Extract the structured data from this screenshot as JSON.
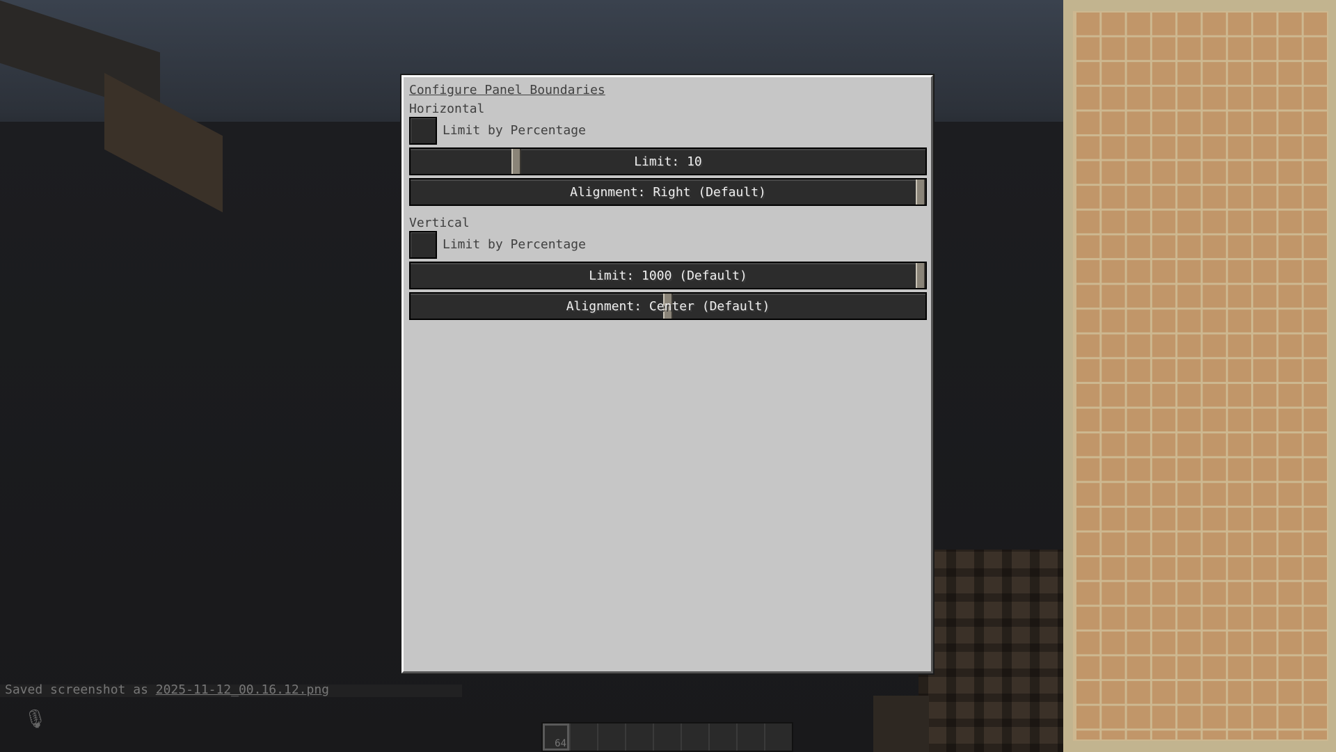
{
  "dialog": {
    "title": "Configure Panel Boundaries",
    "horizontal": {
      "label": "Horizontal",
      "limit_by_percentage_label": "Limit by Percentage",
      "limit_by_percentage_checked": false,
      "limit_slider_text": "Limit: 10",
      "limit_slider_level": 0.2,
      "alignment_slider_text": "Alignment: Right (Default)",
      "alignment_slider_level": 1.0
    },
    "vertical": {
      "label": "Vertical",
      "limit_by_percentage_label": "Limit by Percentage",
      "limit_by_percentage_checked": false,
      "limit_slider_text": "Limit: 1000 (Default)",
      "limit_slider_level": 1.0,
      "alignment_slider_text": "Alignment: Center (Default)",
      "alignment_slider_level": 0.5
    }
  },
  "chat": {
    "prefix": "Saved screenshot as ",
    "filename": "2025-11-12_00.16.12.png"
  },
  "hotbar": {
    "selected_slot": 1,
    "selected_count": "64",
    "slot_count": 9
  },
  "icons": {
    "mic": "microphone-icon"
  },
  "colors": {
    "dialog_bg": "#c6c6c6",
    "slider_bg": "#2c2c2c",
    "panel_grid": "#c19669"
  }
}
